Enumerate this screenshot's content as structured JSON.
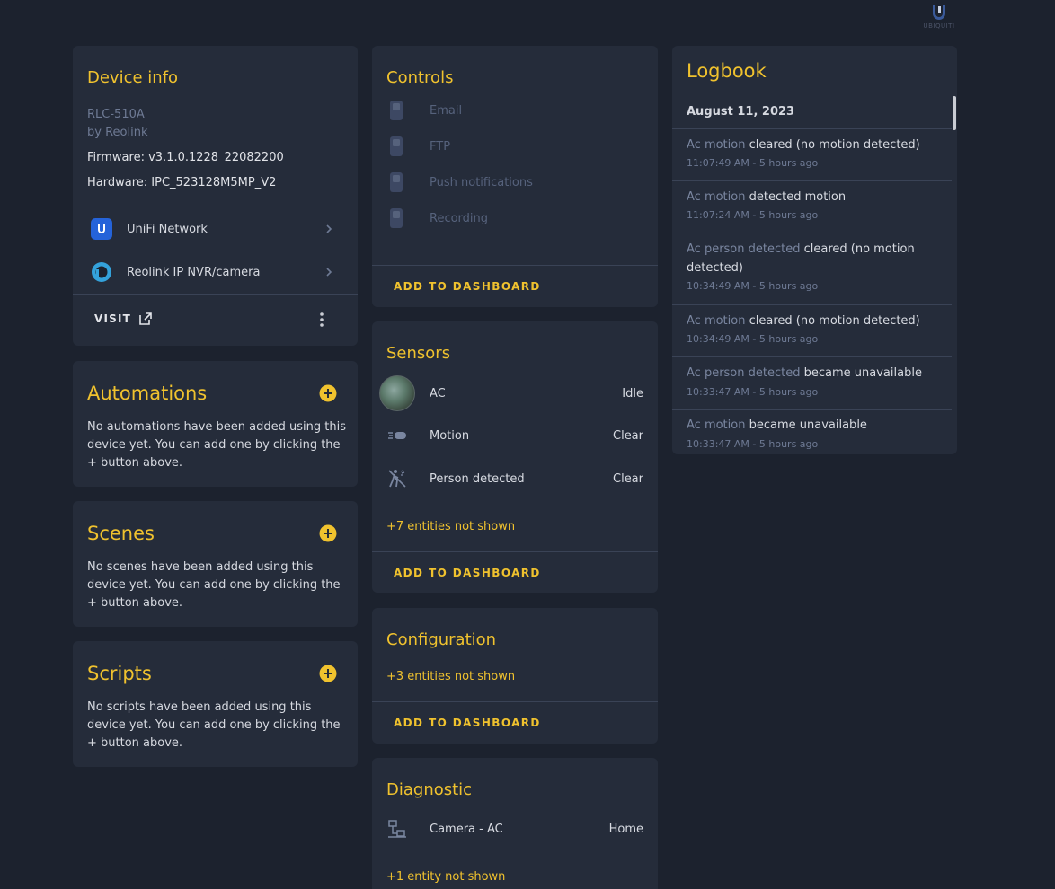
{
  "brand": {
    "logo_text": "UBIQUITI"
  },
  "device_info": {
    "title": "Device info",
    "model": "RLC-510A",
    "manufacturer": "by Reolink",
    "firmware": "Firmware: v3.1.0.1228_22082200",
    "hardware": "Hardware: IPC_523128M5MP_V2",
    "integrations": [
      {
        "label": "UniFi Network",
        "icon": "unifi-icon"
      },
      {
        "label": "Reolink IP NVR/camera",
        "icon": "reolink-icon"
      }
    ],
    "visit_label": "VISIT"
  },
  "automations": {
    "title": "Automations",
    "text": "No automations have been added using this device yet. You can add one by clicking the + button above."
  },
  "scenes": {
    "title": "Scenes",
    "text": "No scenes have been added using this device yet. You can add one by clicking the + button above."
  },
  "scripts": {
    "title": "Scripts",
    "text": "No scripts have been added using this device yet. You can add one by clicking the + button above."
  },
  "controls": {
    "title": "Controls",
    "items": [
      "Email",
      "FTP",
      "Push notifications",
      "Recording"
    ],
    "add_label": "ADD TO DASHBOARD"
  },
  "sensors": {
    "title": "Sensors",
    "items": [
      {
        "label": "AC",
        "value": "Idle"
      },
      {
        "label": "Motion",
        "value": "Clear"
      },
      {
        "label": "Person detected",
        "value": "Clear"
      }
    ],
    "not_shown": "+7 entities not shown",
    "add_label": "ADD TO DASHBOARD"
  },
  "configuration": {
    "title": "Configuration",
    "not_shown": "+3 entities not shown",
    "add_label": "ADD TO DASHBOARD"
  },
  "diagnostic": {
    "title": "Diagnostic",
    "items": [
      {
        "label": "Camera - AC",
        "value": "Home"
      }
    ],
    "not_shown": "+1 entity not shown"
  },
  "logbook": {
    "title": "Logbook",
    "date": "August 11, 2023",
    "entries": [
      {
        "entity": "Ac motion",
        "message": "cleared (no motion detected)",
        "time": "11:07:49 AM - 5 hours ago"
      },
      {
        "entity": "Ac motion",
        "message": "detected motion",
        "time": "11:07:24 AM - 5 hours ago"
      },
      {
        "entity": "Ac person detected",
        "message": "cleared (no motion detected)",
        "time": "10:34:49 AM - 5 hours ago"
      },
      {
        "entity": "Ac motion",
        "message": "cleared (no motion detected)",
        "time": "10:34:49 AM - 5 hours ago"
      },
      {
        "entity": "Ac person detected",
        "message": "became unavailable",
        "time": "10:33:47 AM - 5 hours ago"
      },
      {
        "entity": "Ac motion",
        "message": "became unavailable",
        "time": "10:33:47 AM - 5 hours ago"
      }
    ]
  },
  "colors": {
    "accent": "#f0c22e",
    "card": "#252c3a",
    "background": "#1c222e"
  }
}
